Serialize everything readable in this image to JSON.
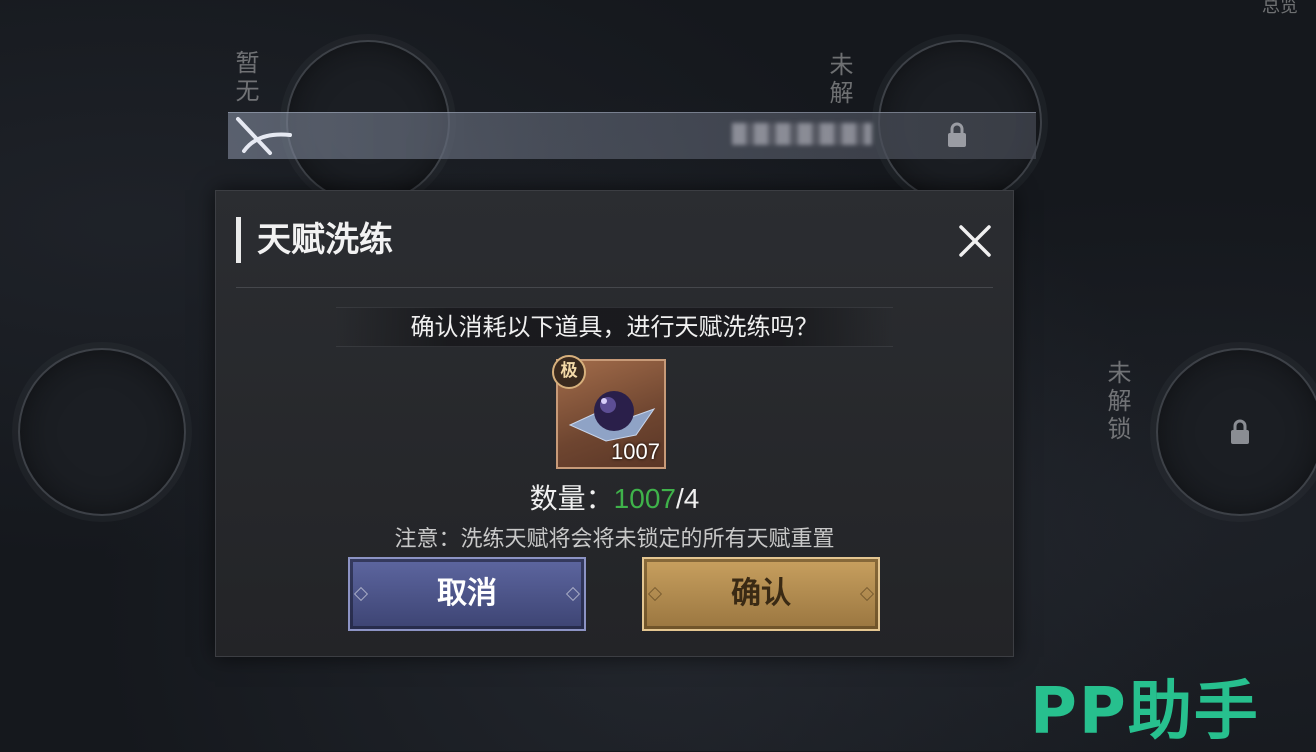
{
  "background": {
    "left_slot_label": "暂无",
    "right_top_slot_label": "未解",
    "right_slot_label": "未解锁",
    "corner_label": "总览"
  },
  "dialog": {
    "title": "天赋洗练",
    "prompt": "确认消耗以下道具，进行天赋洗练吗？",
    "item": {
      "grade_badge": "极",
      "count": "1007",
      "icon": "talent-orb-icon"
    },
    "quantity": {
      "label": "数量：",
      "have": "1007",
      "separator": "/",
      "need": "4"
    },
    "note": "注意：洗练天赋将会将未锁定的所有天赋重置",
    "cancel_label": "取消",
    "confirm_label": "确认"
  },
  "watermark": "PP助手",
  "colors": {
    "have_green": "#3fb24a",
    "cancel_purple": "#4d5588",
    "confirm_gold": "#b48c4f",
    "watermark_green": "#27c08e"
  }
}
